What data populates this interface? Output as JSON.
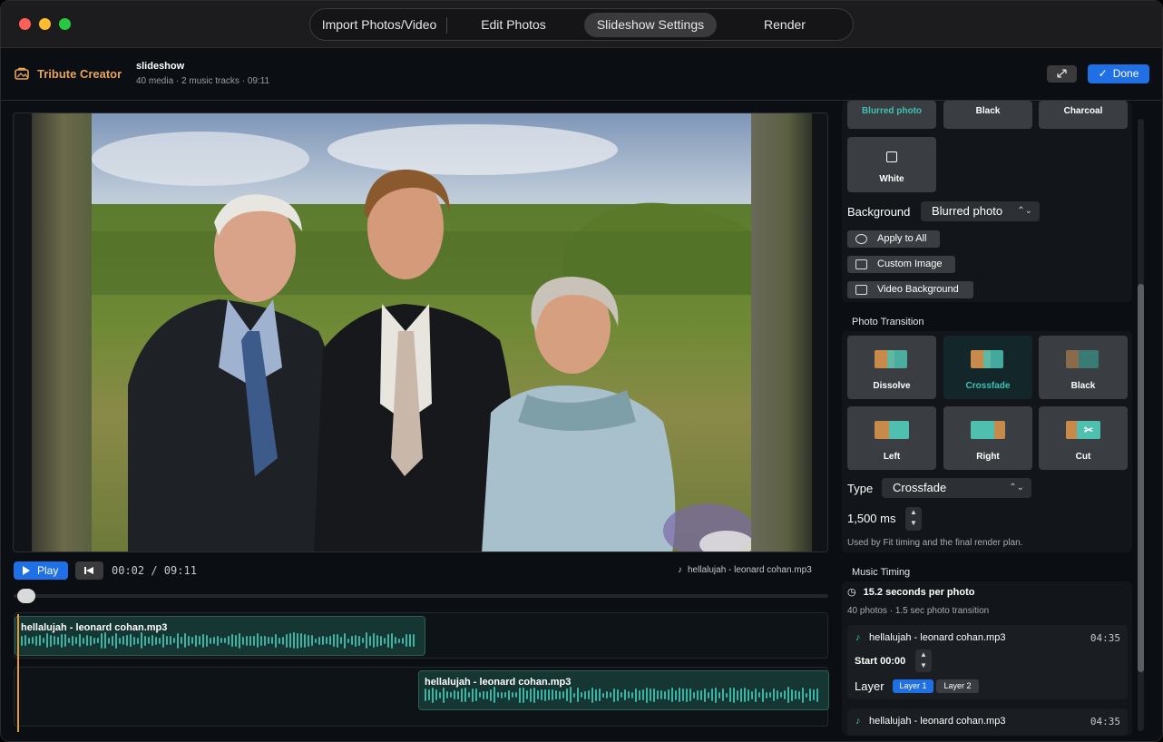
{
  "titlebar": {
    "tabs": [
      {
        "label": "Import Photos/Video",
        "active": false
      },
      {
        "label": "Edit Photos",
        "active": false
      },
      {
        "label": "Slideshow Settings",
        "active": true
      },
      {
        "label": "Render",
        "active": false
      }
    ]
  },
  "header": {
    "app_name": "Tribute Creator",
    "project_name": "slideshow",
    "project_meta": "40 media · 2 music tracks · 09:11",
    "done_label": "Done"
  },
  "transport": {
    "play_label": "Play",
    "timecode": "00:02 / 09:11",
    "now_playing": "hellalujah - leonard cohan.mp3",
    "progress": 0.004
  },
  "tracks": [
    {
      "title": "hellalujah - leonard cohan.mp3"
    },
    {
      "title": "hellalujah - leonard cohan.mp3"
    }
  ],
  "panel": {
    "bg_tiles_top": [
      "Blurred photo",
      "Black",
      "Charcoal"
    ],
    "bg_tile_white": "White",
    "background_label": "Background",
    "background_value": "Blurred photo",
    "apply_all": "Apply to All",
    "custom_image": "Custom Image",
    "video_background": "Video Background",
    "transition_section": "Photo Transition",
    "transitions": [
      {
        "label": "Dissolve",
        "selected": false
      },
      {
        "label": "Crossfade",
        "selected": true
      },
      {
        "label": "Black",
        "selected": false
      },
      {
        "label": "Left",
        "selected": false
      },
      {
        "label": "Right",
        "selected": false
      },
      {
        "label": "Cut",
        "selected": false
      }
    ],
    "type_label": "Type",
    "type_value": "Crossfade",
    "duration_value": "1,500 ms",
    "duration_note": "Used by Fit timing and the final render plan.",
    "music_section": "Music Timing",
    "seconds_per_photo": "15.2 seconds per photo",
    "music_summary": "40 photos · 1.5 sec photo transition",
    "music_tracks": [
      {
        "name": "hellalujah - leonard cohan.mp3",
        "duration": "04:35",
        "start": "Start 00:00",
        "layer_label": "Layer",
        "layers": [
          "Layer 1",
          "Layer 2"
        ],
        "selected_layer": "Layer 1"
      },
      {
        "name": "hellalujah - leonard cohan.mp3",
        "duration": "04:35"
      }
    ]
  },
  "colors": {
    "accent": "#1f6fe5",
    "teal": "#3fc0b4",
    "brand": "#e5a35c",
    "playhead": "#e29a35"
  }
}
